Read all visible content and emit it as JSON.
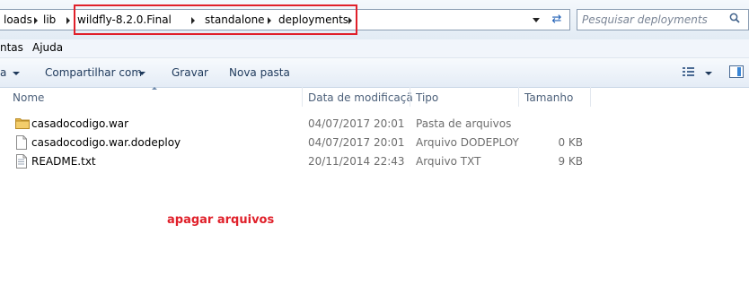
{
  "address_bar": {
    "crumbs": [
      "loads",
      "lib",
      "wildfly-8.2.0.Final",
      "standalone",
      "deployments"
    ]
  },
  "search": {
    "placeholder": "Pesquisar deployments"
  },
  "menu": {
    "items": [
      "ntas",
      "Ajuda"
    ]
  },
  "toolbar": {
    "left_fragment": "a",
    "share_label": "Compartilhar com",
    "burn_label": "Gravar",
    "new_folder_label": "Nova pasta"
  },
  "columns": {
    "name": "Nome",
    "date": "Data de modificaçã",
    "type": "Tipo",
    "size": "Tamanho"
  },
  "files": [
    {
      "name": "casadocodigo.war",
      "date": "04/07/2017 20:01",
      "type": "Pasta de arquivos",
      "size": "",
      "icon": "folder-icon"
    },
    {
      "name": "casadocodigo.war.dodeploy",
      "date": "04/07/2017 20:01",
      "type": "Arquivo DODEPLOY",
      "size": "0 KB",
      "icon": "blank-file-icon"
    },
    {
      "name": "README.txt",
      "date": "20/11/2014 22:43",
      "type": "Arquivo TXT",
      "size": "9 KB",
      "icon": "text-file-icon"
    }
  ],
  "annotation": {
    "text": "apagar arquivos",
    "color": "#e0202a"
  },
  "colors": {
    "highlight": "#e0202a",
    "folder": "#e8b84a"
  }
}
